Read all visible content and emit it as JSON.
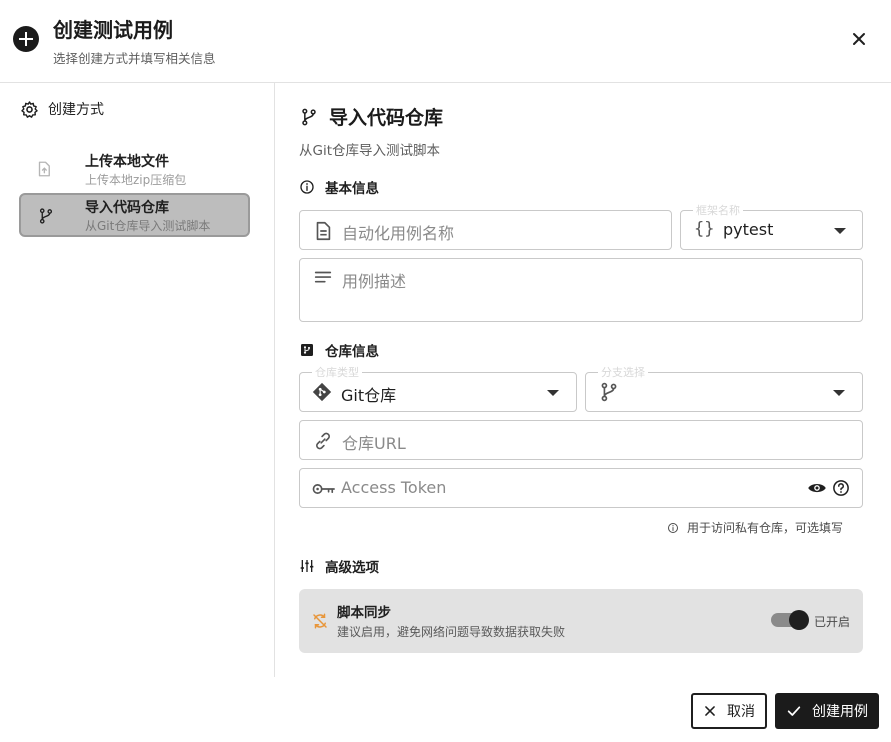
{
  "dialog": {
    "title": "创建测试用例",
    "subtitle": "选择创建方式并填写相关信息"
  },
  "sidebar": {
    "heading": "创建方式",
    "items": [
      {
        "label": "上传本地文件",
        "desc": "上传本地zip压缩包",
        "icon": "file-upload-icon",
        "selected": false
      },
      {
        "label": "导入代码仓库",
        "desc": "从Git仓库导入测试脚本",
        "icon": "git-branch-icon",
        "selected": true
      }
    ]
  },
  "main": {
    "title": "导入代码仓库",
    "subtitle": "从Git仓库导入测试脚本",
    "basic": {
      "heading": "基本信息",
      "name_placeholder": "自动化用例名称",
      "framework_label": "框架名称",
      "framework_value": "pytest",
      "desc_placeholder": "用例描述"
    },
    "repo": {
      "heading": "仓库信息",
      "type_label": "仓库类型",
      "type_value": "Git仓库",
      "branch_label": "分支选择",
      "branch_value": "",
      "url_placeholder": "仓库URL",
      "token_placeholder": "Access Token",
      "hint": "用于访问私有仓库，可选填写"
    },
    "advanced": {
      "heading": "高级选项",
      "sync_title": "脚本同步",
      "sync_desc": "建议启用，避免网络问题导致数据获取失败",
      "sync_state": "已开启",
      "sync_enabled": true
    }
  },
  "footer": {
    "cancel_label": "取消",
    "create_label": "创建用例"
  },
  "colors": {
    "primary": "#1b1b1b",
    "selected_bg": "#bdbdbd",
    "sync_warn_icon": "#e8963a"
  }
}
